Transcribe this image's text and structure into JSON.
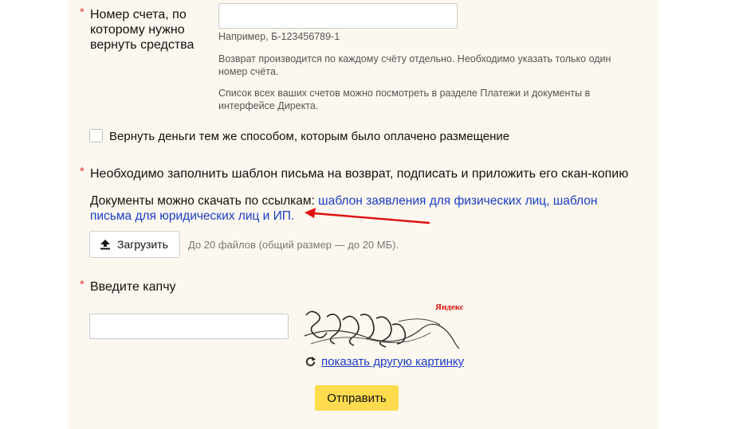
{
  "account_field": {
    "required_mark": "*",
    "label": "Номер счета, по которому нужно вернуть средства",
    "value": "",
    "example": "Например, Б-123456789-1",
    "note1": "Возврат производится по каждому счёту отдельно. Необходимо указать только один номер счёта.",
    "note2": "Список всех ваших счетов можно посмотреть в разделе Платежи и документы в интерфейсе Директа."
  },
  "refund_same_method": {
    "label": "Вернуть деньги тем же способом, которым было оплачено размещение",
    "checked": false
  },
  "template_section": {
    "required_mark": "*",
    "title": "Необходимо заполнить шаблон письма на возврат, подписать и приложить его скан-копию",
    "docs_prefix": "Документы можно скачать по ссылкам: ",
    "link_individual": "шаблон заявления для физических лиц,",
    "link_legal": "шаблон письма для юридических лиц и ИП.",
    "upload_button": "Загрузить",
    "upload_icon": "upload-icon",
    "upload_hint": "До 20 файлов (общий размер — до 20 МБ)."
  },
  "captcha": {
    "required_mark": "*",
    "label": "Введите капчу",
    "value": "",
    "logo_text": "Яндекс",
    "refresh_icon": "refresh-icon",
    "refresh_link": "показать другую картинку"
  },
  "submit_button": "Отправить",
  "colors": {
    "panel_bg": "#fcf8ef",
    "link": "#1a3cc8",
    "required": "#e53935",
    "submit_bg": "#ffdb4d",
    "annotation_arrow": "#e01010"
  }
}
